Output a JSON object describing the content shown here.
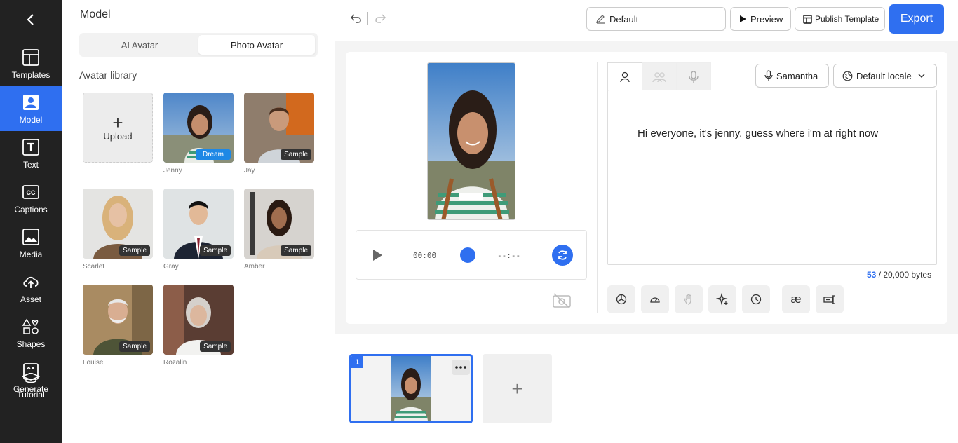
{
  "nav": {
    "items": [
      {
        "label": "Templates",
        "icon": "templates-icon"
      },
      {
        "label": "Model",
        "icon": "model-icon",
        "active": true
      },
      {
        "label": "Text",
        "icon": "text-icon"
      },
      {
        "label": "Captions",
        "icon": "captions-icon"
      },
      {
        "label": "Media",
        "icon": "media-icon"
      },
      {
        "label": "Asset",
        "icon": "asset-icon"
      },
      {
        "label": "Shapes",
        "icon": "shapes-icon"
      },
      {
        "label": "Generate",
        "icon": "generate-icon"
      }
    ],
    "tutorial": "Tutorial"
  },
  "panel": {
    "title": "Model",
    "tabs": [
      "AI Avatar",
      "Photo Avatar"
    ],
    "active_tab": "Photo Avatar",
    "library_title": "Avatar library",
    "upload_label": "Upload",
    "avatars": [
      {
        "name": "Jenny",
        "badge": "Dream"
      },
      {
        "name": "Jay",
        "badge": "Sample"
      },
      {
        "name": "Scarlet",
        "badge": "Sample"
      },
      {
        "name": "Gray",
        "badge": "Sample"
      },
      {
        "name": "Amber",
        "badge": "Sample"
      },
      {
        "name": "Louise",
        "badge": "Sample"
      },
      {
        "name": "Rozalin",
        "badge": "Sample"
      }
    ]
  },
  "toolbar": {
    "title_value": "Default",
    "preview": "Preview",
    "publish": "Publish Template",
    "export": "Export"
  },
  "player": {
    "current_time": "00:00",
    "total_time": "--:--"
  },
  "script": {
    "voice": "Samantha",
    "locale": "Default locale",
    "text": "Hi everyone, it's jenny. guess where i'm at right now",
    "bytes_used": "53",
    "bytes_limit": "/ 20,000 bytes"
  },
  "timeline": {
    "slide_number": "1"
  },
  "colors": {
    "accent": "#2f6ff0",
    "sidebar": "#222222",
    "dream_badge": "#1e88e5"
  }
}
